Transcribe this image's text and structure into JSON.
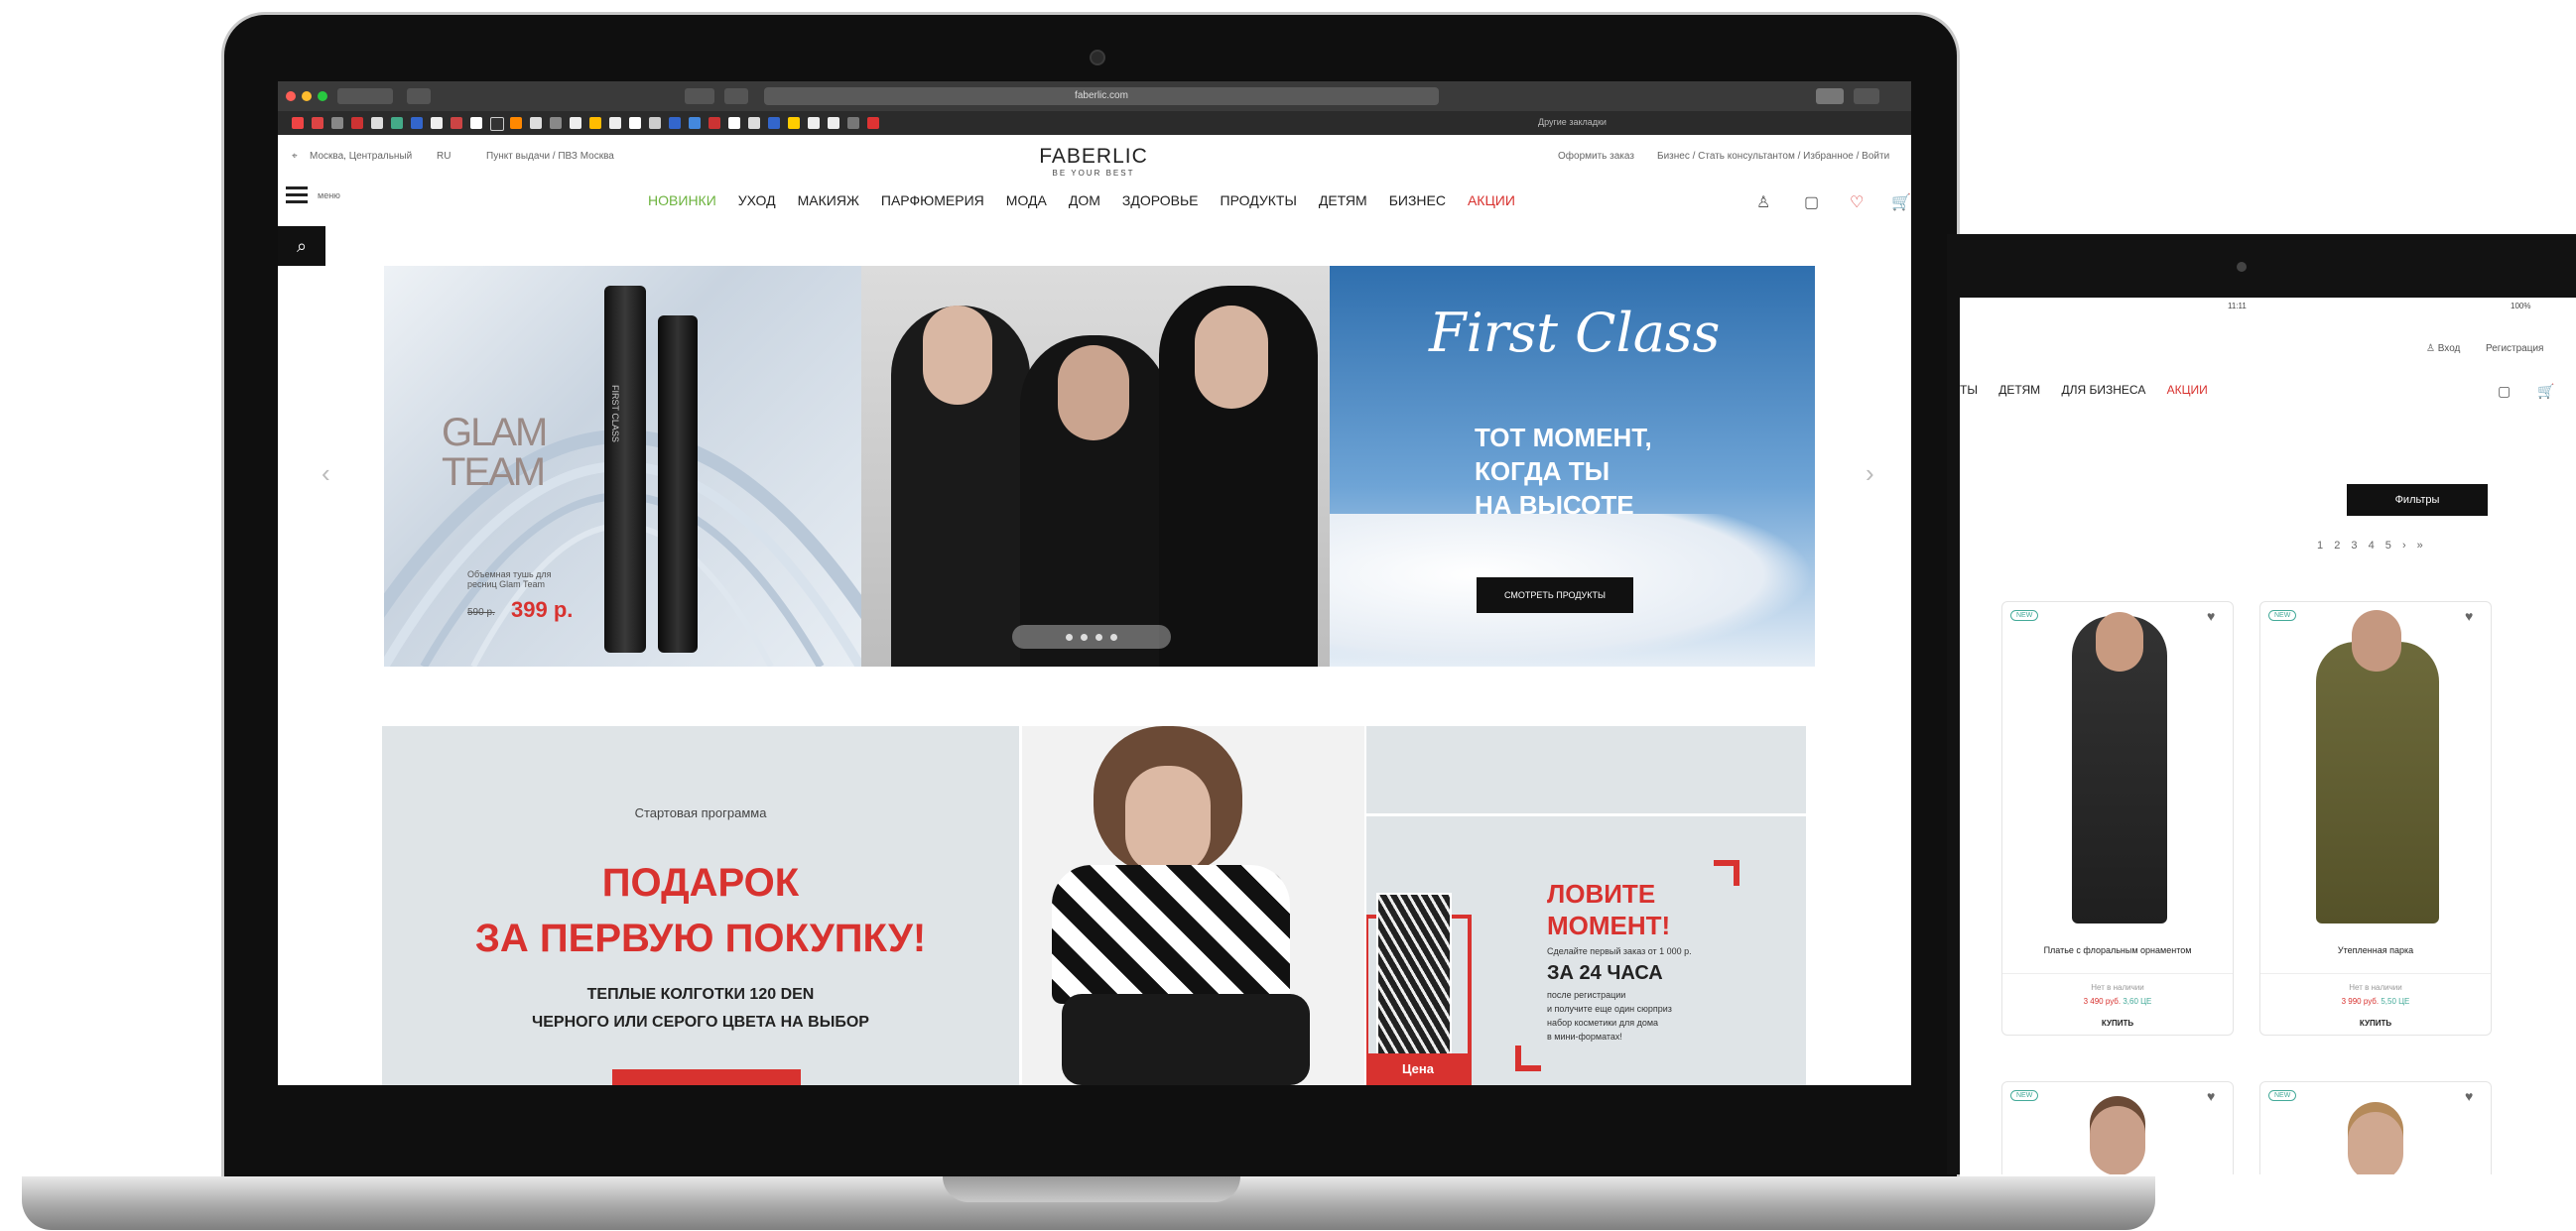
{
  "browser": {
    "url": "faberlic.com",
    "bookmarks_right": "Другие закладки"
  },
  "site": {
    "logo": "FABERLIC",
    "logo_sub": "BE YOUR BEST",
    "util_left": [
      "Москва, Центральный",
      "RU",
      "Пункт выдачи / ПВЗ Москва"
    ],
    "util_right": [
      "Оформить заказ",
      "Бизнес / Стать консультантом / Избранное / Войти"
    ],
    "menu_label": "меню",
    "nav": [
      "НОВИНКИ",
      "УХОД",
      "МАКИЯЖ",
      "ПАРФЮМЕРИЯ",
      "МОДА",
      "ДОМ",
      "ЗДОРОВЬЕ",
      "ПРОДУКТЫ",
      "ДЕТЯМ",
      "БИЗНЕС",
      "АКЦИИ"
    ],
    "nav_colors": {
      "new": "#6db33f",
      "sale": "#d8322f"
    }
  },
  "slider": {
    "left_brand": "GLAM TEAM",
    "left_price_text": "Объемная тушь для ресниц Glam Team",
    "left_old_price": "590 р.",
    "left_price": "399 р.",
    "mascara_label": "FIRST CLASS",
    "right_script": "First Class",
    "right_headline": [
      "ТОТ МОМЕНТ,",
      "КОГДА ТЫ",
      "НА ВЫСОТЕ"
    ],
    "right_button": "СМОТРЕТЬ ПРОДУКТЫ",
    "prev": "‹",
    "next": "›"
  },
  "promo": {
    "kicker": "Стартовая программа",
    "title_1": "ПОДАРОК",
    "title_2": "ЗА ПЕРВУЮ ПОКУПКУ!",
    "sub_1": "ТЕПЛЫЕ КОЛГОТКИ 120 DEN",
    "sub_2": "ЧЕРНОГО ИЛИ СЕРОГО ЦВЕТА НА ВЫБОР",
    "price_tag": "Цена",
    "catch_1": "ЛОВИТЕ",
    "catch_2": "МОМЕНТ!",
    "catch_note": "Сделайте первый заказ от 1 000 р.",
    "catch_time": "ЗА 24 ЧАСА",
    "catch_body": [
      "после регистрации",
      "и получите еще один сюрприз",
      "набор косметики для дома",
      "в мини-форматах!"
    ]
  },
  "tablet": {
    "status_time": "11:11",
    "battery": "100%",
    "login": "Вход",
    "register": "Регистрация",
    "nav": [
      "ТЫ",
      "ДЕТЯМ",
      "ДЛЯ БИЗНЕСА",
      "АКЦИИ"
    ],
    "filter_button": "Фильтры",
    "pages": [
      "1",
      "2",
      "3",
      "4",
      "5",
      "›",
      "»"
    ],
    "products": [
      {
        "badge": "NEW",
        "name": "Платье с флоральным орнаментом",
        "stock": "Нет в наличии",
        "price": "3 490 руб.",
        "pv": "3,60 ЦЕ",
        "btn": "КУПИТЬ"
      },
      {
        "badge": "NEW",
        "name": "Утепленная парка",
        "stock": "Нет в наличии",
        "price": "3 990 руб.",
        "pv": "5,50 ЦЕ",
        "btn": "КУПИТЬ"
      }
    ],
    "products_row2_badges": [
      "NEW",
      "NEW"
    ]
  }
}
